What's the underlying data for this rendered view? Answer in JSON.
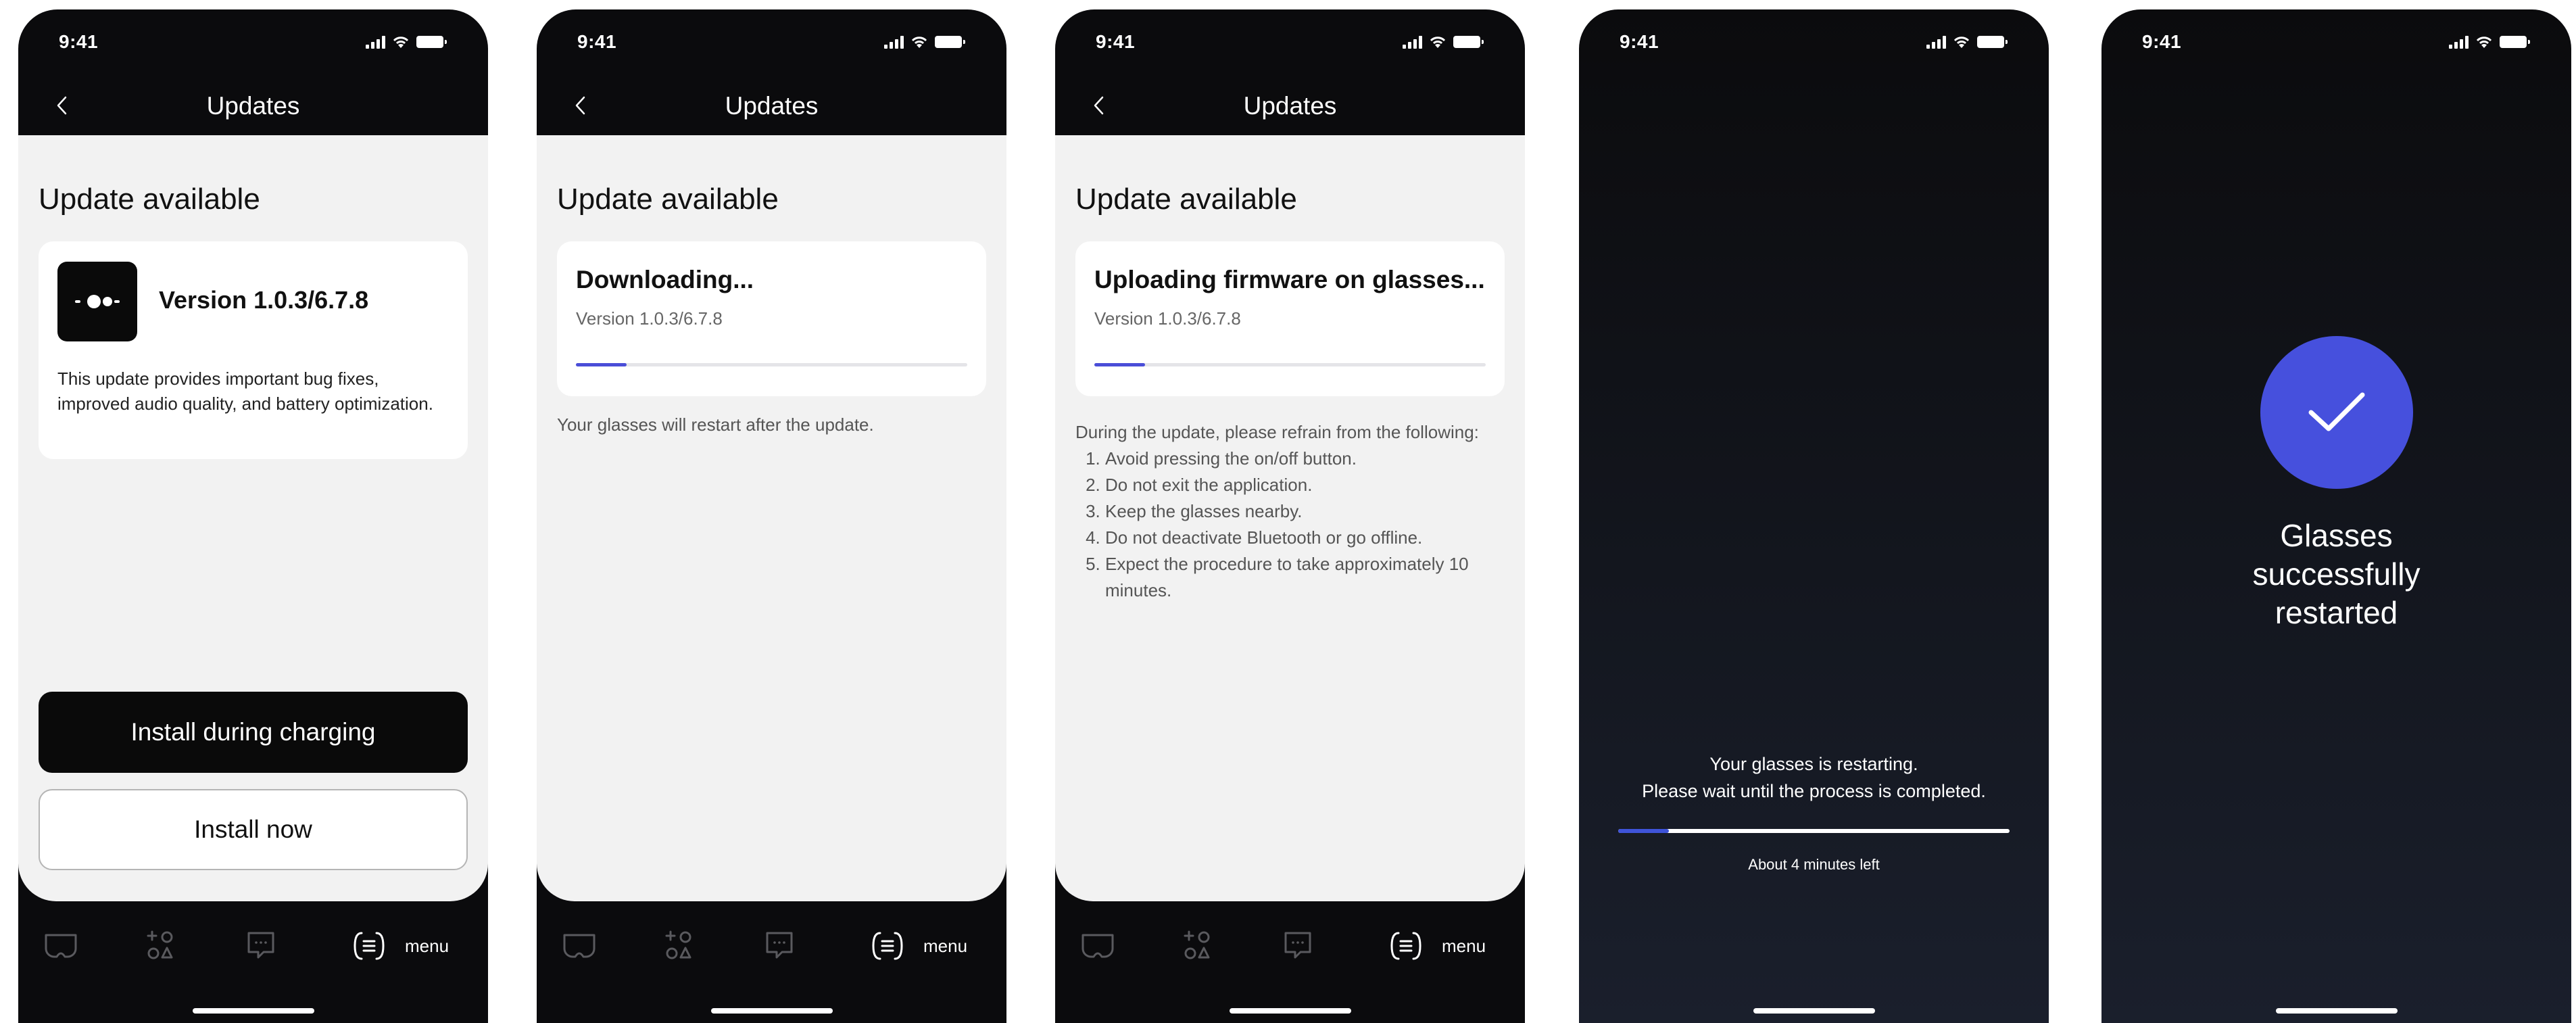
{
  "status_time": "9:41",
  "nav_title": "Updates",
  "section_title": "Update available",
  "screen1": {
    "version": "Version 1.0.3/6.7.8",
    "description": "This update provides important bug fixes, improved audio quality, and battery optimization.",
    "btn_primary": "Install during charging",
    "btn_secondary": "Install now"
  },
  "screen2": {
    "heading": "Downloading...",
    "version": "Version 1.0.3/6.7.8",
    "progress": 0.13,
    "note": "Your glasses will restart after the update."
  },
  "screen3": {
    "heading": "Uploading firmware on glasses...",
    "version": "Version 1.0.3/6.7.8",
    "progress": 0.13,
    "intro": "During the update, please refrain from the following:",
    "steps": [
      "Avoid pressing the on/off button.",
      "Do not exit the application.",
      "Keep the glasses nearby.",
      "Do not deactivate Bluetooth or go offline.",
      "Expect the procedure to take approximately 10 minutes."
    ]
  },
  "screen4": {
    "line1": "Your glasses is restarting.",
    "line2": "Please wait until the process is completed.",
    "progress": 0.13,
    "time_left": "About 4 minutes left"
  },
  "screen5": {
    "message": "Glasses successfully restarted"
  },
  "tabbar": {
    "menu_label": "menu"
  },
  "colors": {
    "accent": "#4a4ed8",
    "success": "#4650dd",
    "dark_bg": "#0b0b0d",
    "sheet_bg": "#f2f2f2"
  },
  "icons": {
    "back": "chevron-left-icon",
    "glasses_tab": "glasses-icon",
    "connect_tab": "connect-icon",
    "chat_tab": "chat-icon",
    "menu_tab": "menu-icon",
    "success": "check-icon"
  }
}
